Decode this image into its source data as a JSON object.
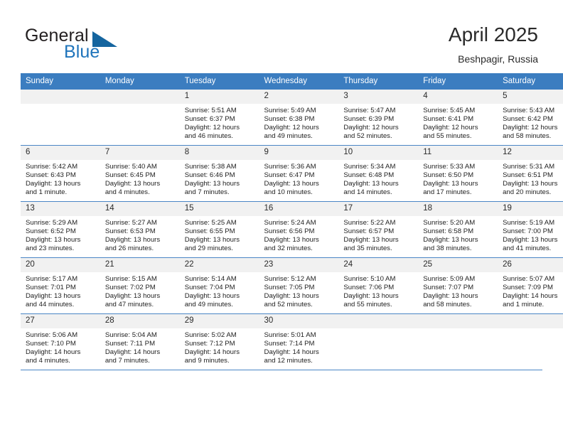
{
  "brand": {
    "name_part1": "General",
    "name_part2": "Blue",
    "logo_icon": "triangle-logo-icon"
  },
  "header": {
    "month_title": "April 2025",
    "location": "Beshpagir, Russia"
  },
  "calendar": {
    "weekday_headers": [
      "Sunday",
      "Monday",
      "Tuesday",
      "Wednesday",
      "Thursday",
      "Friday",
      "Saturday"
    ],
    "accent_color": "#3b7dc0",
    "daynum_bg": "#f1f1f1",
    "weeks": [
      [
        {
          "day": "",
          "sunrise": "",
          "sunset": "",
          "daylight_line1": "",
          "daylight_line2": ""
        },
        {
          "day": "",
          "sunrise": "",
          "sunset": "",
          "daylight_line1": "",
          "daylight_line2": ""
        },
        {
          "day": "1",
          "sunrise": "Sunrise: 5:51 AM",
          "sunset": "Sunset: 6:37 PM",
          "daylight_line1": "Daylight: 12 hours",
          "daylight_line2": "and 46 minutes."
        },
        {
          "day": "2",
          "sunrise": "Sunrise: 5:49 AM",
          "sunset": "Sunset: 6:38 PM",
          "daylight_line1": "Daylight: 12 hours",
          "daylight_line2": "and 49 minutes."
        },
        {
          "day": "3",
          "sunrise": "Sunrise: 5:47 AM",
          "sunset": "Sunset: 6:39 PM",
          "daylight_line1": "Daylight: 12 hours",
          "daylight_line2": "and 52 minutes."
        },
        {
          "day": "4",
          "sunrise": "Sunrise: 5:45 AM",
          "sunset": "Sunset: 6:41 PM",
          "daylight_line1": "Daylight: 12 hours",
          "daylight_line2": "and 55 minutes."
        },
        {
          "day": "5",
          "sunrise": "Sunrise: 5:43 AM",
          "sunset": "Sunset: 6:42 PM",
          "daylight_line1": "Daylight: 12 hours",
          "daylight_line2": "and 58 minutes."
        }
      ],
      [
        {
          "day": "6",
          "sunrise": "Sunrise: 5:42 AM",
          "sunset": "Sunset: 6:43 PM",
          "daylight_line1": "Daylight: 13 hours",
          "daylight_line2": "and 1 minute."
        },
        {
          "day": "7",
          "sunrise": "Sunrise: 5:40 AM",
          "sunset": "Sunset: 6:45 PM",
          "daylight_line1": "Daylight: 13 hours",
          "daylight_line2": "and 4 minutes."
        },
        {
          "day": "8",
          "sunrise": "Sunrise: 5:38 AM",
          "sunset": "Sunset: 6:46 PM",
          "daylight_line1": "Daylight: 13 hours",
          "daylight_line2": "and 7 minutes."
        },
        {
          "day": "9",
          "sunrise": "Sunrise: 5:36 AM",
          "sunset": "Sunset: 6:47 PM",
          "daylight_line1": "Daylight: 13 hours",
          "daylight_line2": "and 10 minutes."
        },
        {
          "day": "10",
          "sunrise": "Sunrise: 5:34 AM",
          "sunset": "Sunset: 6:48 PM",
          "daylight_line1": "Daylight: 13 hours",
          "daylight_line2": "and 14 minutes."
        },
        {
          "day": "11",
          "sunrise": "Sunrise: 5:33 AM",
          "sunset": "Sunset: 6:50 PM",
          "daylight_line1": "Daylight: 13 hours",
          "daylight_line2": "and 17 minutes."
        },
        {
          "day": "12",
          "sunrise": "Sunrise: 5:31 AM",
          "sunset": "Sunset: 6:51 PM",
          "daylight_line1": "Daylight: 13 hours",
          "daylight_line2": "and 20 minutes."
        }
      ],
      [
        {
          "day": "13",
          "sunrise": "Sunrise: 5:29 AM",
          "sunset": "Sunset: 6:52 PM",
          "daylight_line1": "Daylight: 13 hours",
          "daylight_line2": "and 23 minutes."
        },
        {
          "day": "14",
          "sunrise": "Sunrise: 5:27 AM",
          "sunset": "Sunset: 6:53 PM",
          "daylight_line1": "Daylight: 13 hours",
          "daylight_line2": "and 26 minutes."
        },
        {
          "day": "15",
          "sunrise": "Sunrise: 5:25 AM",
          "sunset": "Sunset: 6:55 PM",
          "daylight_line1": "Daylight: 13 hours",
          "daylight_line2": "and 29 minutes."
        },
        {
          "day": "16",
          "sunrise": "Sunrise: 5:24 AM",
          "sunset": "Sunset: 6:56 PM",
          "daylight_line1": "Daylight: 13 hours",
          "daylight_line2": "and 32 minutes."
        },
        {
          "day": "17",
          "sunrise": "Sunrise: 5:22 AM",
          "sunset": "Sunset: 6:57 PM",
          "daylight_line1": "Daylight: 13 hours",
          "daylight_line2": "and 35 minutes."
        },
        {
          "day": "18",
          "sunrise": "Sunrise: 5:20 AM",
          "sunset": "Sunset: 6:58 PM",
          "daylight_line1": "Daylight: 13 hours",
          "daylight_line2": "and 38 minutes."
        },
        {
          "day": "19",
          "sunrise": "Sunrise: 5:19 AM",
          "sunset": "Sunset: 7:00 PM",
          "daylight_line1": "Daylight: 13 hours",
          "daylight_line2": "and 41 minutes."
        }
      ],
      [
        {
          "day": "20",
          "sunrise": "Sunrise: 5:17 AM",
          "sunset": "Sunset: 7:01 PM",
          "daylight_line1": "Daylight: 13 hours",
          "daylight_line2": "and 44 minutes."
        },
        {
          "day": "21",
          "sunrise": "Sunrise: 5:15 AM",
          "sunset": "Sunset: 7:02 PM",
          "daylight_line1": "Daylight: 13 hours",
          "daylight_line2": "and 47 minutes."
        },
        {
          "day": "22",
          "sunrise": "Sunrise: 5:14 AM",
          "sunset": "Sunset: 7:04 PM",
          "daylight_line1": "Daylight: 13 hours",
          "daylight_line2": "and 49 minutes."
        },
        {
          "day": "23",
          "sunrise": "Sunrise: 5:12 AM",
          "sunset": "Sunset: 7:05 PM",
          "daylight_line1": "Daylight: 13 hours",
          "daylight_line2": "and 52 minutes."
        },
        {
          "day": "24",
          "sunrise": "Sunrise: 5:10 AM",
          "sunset": "Sunset: 7:06 PM",
          "daylight_line1": "Daylight: 13 hours",
          "daylight_line2": "and 55 minutes."
        },
        {
          "day": "25",
          "sunrise": "Sunrise: 5:09 AM",
          "sunset": "Sunset: 7:07 PM",
          "daylight_line1": "Daylight: 13 hours",
          "daylight_line2": "and 58 minutes."
        },
        {
          "day": "26",
          "sunrise": "Sunrise: 5:07 AM",
          "sunset": "Sunset: 7:09 PM",
          "daylight_line1": "Daylight: 14 hours",
          "daylight_line2": "and 1 minute."
        }
      ],
      [
        {
          "day": "27",
          "sunrise": "Sunrise: 5:06 AM",
          "sunset": "Sunset: 7:10 PM",
          "daylight_line1": "Daylight: 14 hours",
          "daylight_line2": "and 4 minutes."
        },
        {
          "day": "28",
          "sunrise": "Sunrise: 5:04 AM",
          "sunset": "Sunset: 7:11 PM",
          "daylight_line1": "Daylight: 14 hours",
          "daylight_line2": "and 7 minutes."
        },
        {
          "day": "29",
          "sunrise": "Sunrise: 5:02 AM",
          "sunset": "Sunset: 7:12 PM",
          "daylight_line1": "Daylight: 14 hours",
          "daylight_line2": "and 9 minutes."
        },
        {
          "day": "30",
          "sunrise": "Sunrise: 5:01 AM",
          "sunset": "Sunset: 7:14 PM",
          "daylight_line1": "Daylight: 14 hours",
          "daylight_line2": "and 12 minutes."
        },
        {
          "day": "",
          "sunrise": "",
          "sunset": "",
          "daylight_line1": "",
          "daylight_line2": ""
        },
        {
          "day": "",
          "sunrise": "",
          "sunset": "",
          "daylight_line1": "",
          "daylight_line2": ""
        },
        {
          "day": "",
          "sunrise": "",
          "sunset": "",
          "daylight_line1": "",
          "daylight_line2": ""
        }
      ]
    ]
  }
}
